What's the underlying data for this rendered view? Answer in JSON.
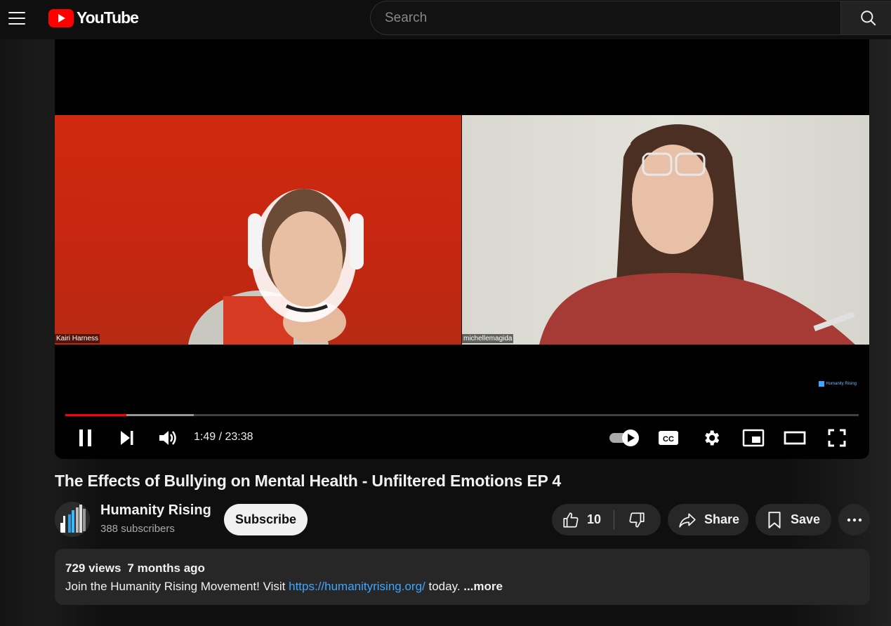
{
  "header": {
    "logo_text": "YouTube",
    "search_placeholder": "Search"
  },
  "player": {
    "participants": [
      "Kairi Harness",
      "michellemagida"
    ],
    "watermark": "Humanity Rising",
    "current_time": "1:49",
    "duration": "23:38",
    "time_display": "1:49 / 23:38",
    "played_fraction": 0.077,
    "buffered_fraction": 0.162,
    "autoplay": "on",
    "controls": [
      "pause",
      "next",
      "volume",
      "autoplay-toggle",
      "captions",
      "settings",
      "miniplayer",
      "theater",
      "fullscreen"
    ]
  },
  "video": {
    "title": "The Effects of Bullying on Mental Health - Unfiltered Emotions EP 4"
  },
  "channel": {
    "name": "Humanity Rising",
    "subscribers": "388 subscribers",
    "subscribe_label": "Subscribe"
  },
  "actions": {
    "like_count": "10",
    "share_label": "Share",
    "save_label": "Save"
  },
  "description": {
    "views": "729 views",
    "age": "7 months ago",
    "text_before": "Join the Humanity Rising Movement! Visit ",
    "link": "https://humanityrising.org/",
    "text_after": " today. ",
    "more_label": "...more"
  },
  "colors": {
    "accent": "#ff0000",
    "link": "#3ea6ff",
    "background": "#0f0f0f",
    "surface": "#272727"
  }
}
